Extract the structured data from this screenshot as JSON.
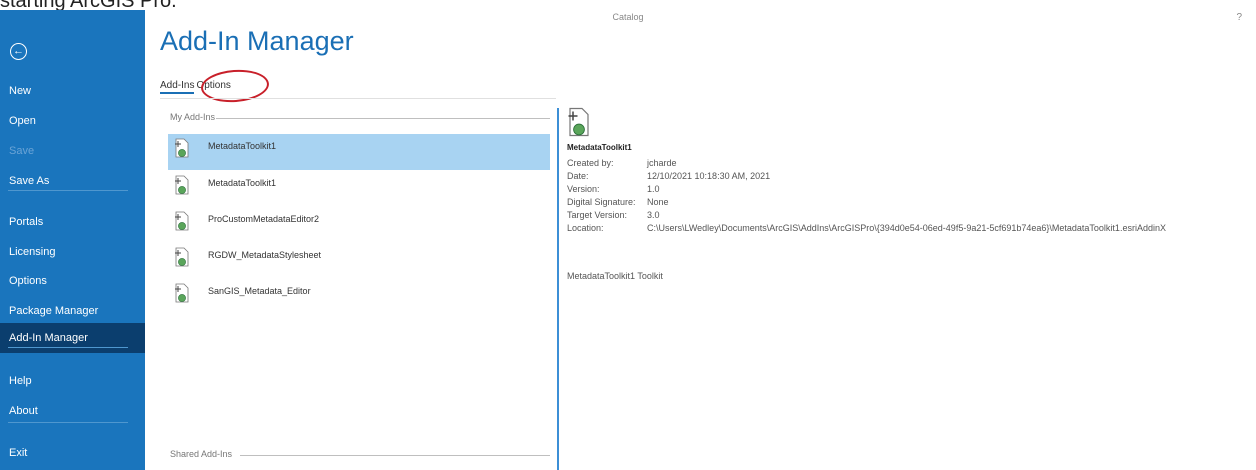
{
  "caption": "starting ArcGIS Pro.",
  "window": {
    "title": "Catalog",
    "help": "?"
  },
  "sidebar": {
    "back_icon": "back-arrow-icon",
    "items": [
      {
        "label": "New",
        "state": "normal"
      },
      {
        "label": "Open",
        "state": "normal"
      },
      {
        "label": "Save",
        "state": "disabled"
      },
      {
        "label": "Save As",
        "state": "normal"
      },
      {
        "label": "Portals",
        "state": "normal"
      },
      {
        "label": "Licensing",
        "state": "normal"
      },
      {
        "label": "Options",
        "state": "normal"
      },
      {
        "label": "Package Manager",
        "state": "normal"
      },
      {
        "label": "Add-In Manager",
        "state": "active"
      },
      {
        "label": "Help",
        "state": "normal"
      },
      {
        "label": "About",
        "state": "normal"
      },
      {
        "label": "Exit",
        "state": "normal"
      }
    ]
  },
  "page_title": "Add-In Manager",
  "tabs": [
    {
      "label": "Add-Ins",
      "active": true
    },
    {
      "label": "Options",
      "active": false
    }
  ],
  "my_addins": {
    "label": "My Add-Ins",
    "items": [
      {
        "name": "MetadataToolkit1",
        "selected": true
      },
      {
        "name": "MetadataToolkit1",
        "selected": false
      },
      {
        "name": "ProCustomMetadataEditor2",
        "selected": false
      },
      {
        "name": "RGDW_MetadataStylesheet",
        "selected": false
      },
      {
        "name": "SanGIS_Metadata_Editor",
        "selected": false
      }
    ]
  },
  "shared_addins": {
    "label": "Shared Add-Ins"
  },
  "details": {
    "name": "MetadataToolkit1",
    "fields": [
      {
        "label": "Created by:",
        "value": "jcharde"
      },
      {
        "label": "Date:",
        "value": "12/10/2021 10:18:30 AM, 2021"
      },
      {
        "label": "Version:",
        "value": "1.0"
      },
      {
        "label": "Digital Signature:",
        "value": "None"
      },
      {
        "label": "Target Version:",
        "value": "3.0"
      },
      {
        "label": "Location:",
        "value": "C:\\Users\\LWedley\\Documents\\ArcGIS\\AddIns\\ArcGISPro\\{394d0e54-06ed-49f5-9a21-5cf691b74ea6}\\MetadataToolkit1.esriAddinX"
      }
    ],
    "description": "MetadataToolkit1 Toolkit"
  },
  "colors": {
    "sidebar": "#1a75bd",
    "active_nav": "#0b3e6e",
    "accent": "#1a6fb5",
    "selection": "#a8d3f2",
    "annotation": "#c8202a"
  }
}
